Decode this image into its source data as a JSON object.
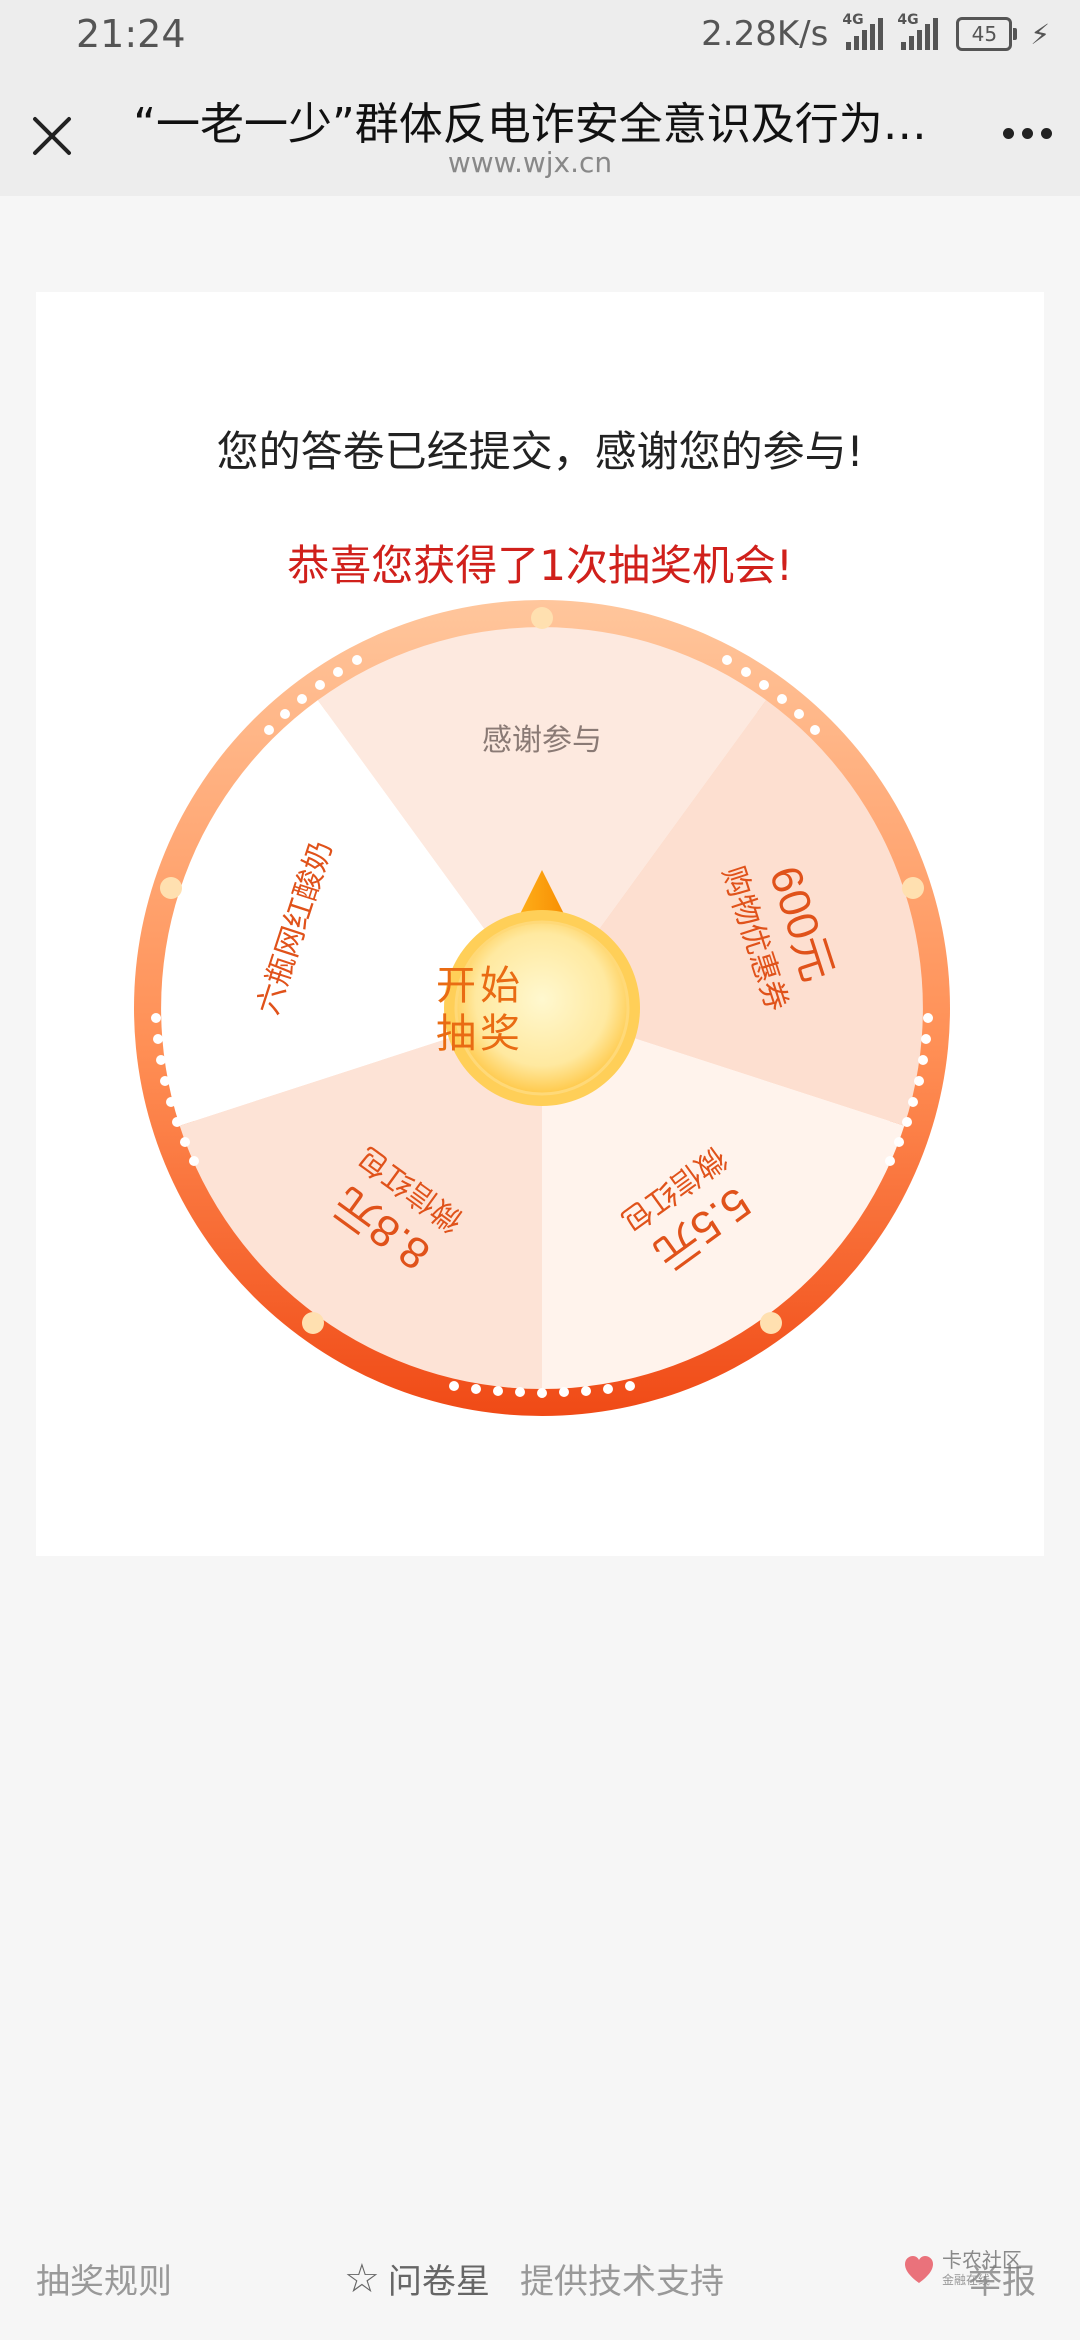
{
  "status_bar": {
    "time": "21:24",
    "net_speed": "2.28K/s",
    "net_type_1": "4G",
    "net_type_2": "4G",
    "battery": "45"
  },
  "nav": {
    "title": "“一老一少”群体反电诈安全意识及行为…",
    "domain": "www.wjx.cn"
  },
  "result": {
    "thanks": "您的答卷已经提交，感谢您的参与!",
    "congrats": "恭喜您获得了1次抽奖机会!"
  },
  "wheel": {
    "start_line1": "开始",
    "start_line2": "抽奖",
    "prizes": [
      {
        "line1": "感谢参与",
        "line2": ""
      },
      {
        "line1": "600元",
        "line2": "购物优惠券"
      },
      {
        "line1": "5.5元",
        "line2": "微信红包"
      },
      {
        "line1": "8.8元",
        "line2": "微信红包"
      },
      {
        "line1": "六瓶网红酸奶",
        "line2": ""
      }
    ],
    "colors": {
      "rim_top": "#ffc79a",
      "rim_bottom": "#f04a16",
      "slice_light": "#fff4ee",
      "slice_dark": "#fde6da",
      "slice_white": "#ffffff",
      "text": "#e0521a"
    }
  },
  "footer": {
    "rules": "抽奖规则",
    "brand": "问卷星",
    "tech": "提供技术支持",
    "report": "举报"
  },
  "watermark": {
    "name": "卡农社区",
    "tagline": "金融在线"
  }
}
